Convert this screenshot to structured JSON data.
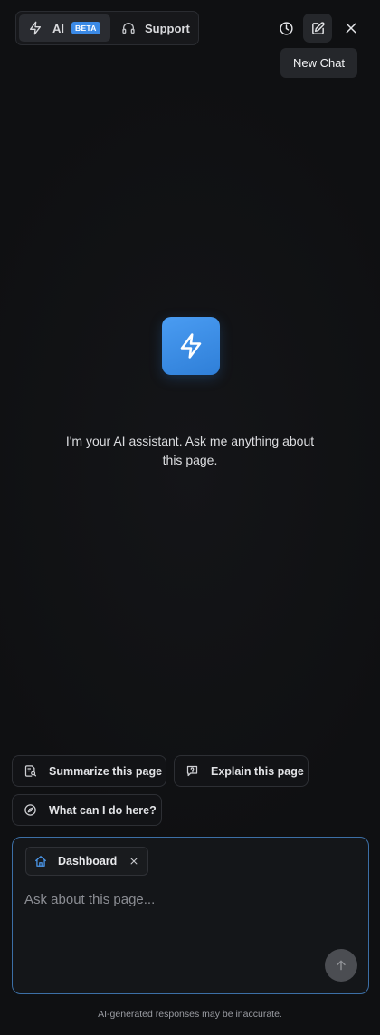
{
  "header": {
    "tabs": {
      "ai_label": "AI",
      "ai_badge": "BETA",
      "support_label": "Support"
    },
    "tooltip": "New Chat",
    "icons": {
      "ai_tab": "lightning-icon",
      "support_tab": "headset-icon",
      "history": "history-clock-icon",
      "new_chat": "edit-pencil-icon",
      "close": "close-icon"
    }
  },
  "empty_state": {
    "icon": "lightning-icon",
    "message": "I'm your AI assistant. Ask me anything about this page."
  },
  "suggestions": {
    "summarize": "Summarize this page",
    "explain": "Explain this page",
    "what_can": "What can I do here?"
  },
  "composer": {
    "context_label": "Dashboard",
    "context_icon": "home-icon",
    "placeholder": "Ask about this page...",
    "send_icon": "arrow-up-icon"
  },
  "footer": {
    "disclaimer": "AI-generated responses may be inaccurate."
  },
  "colors": {
    "accent": "#3b8ae6",
    "background": "#0f1012",
    "composer_border": "#3c6fa6"
  }
}
